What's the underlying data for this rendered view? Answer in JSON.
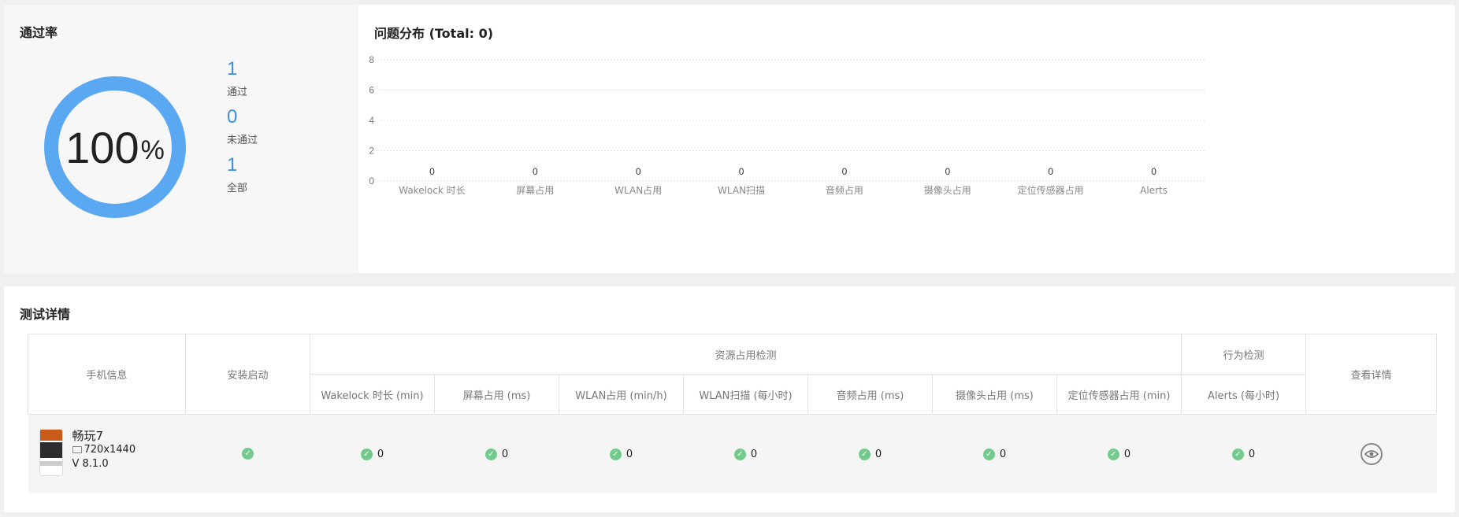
{
  "pass_rate": {
    "title": "通过率",
    "percent_value": "100",
    "percent_sign": "%",
    "pass_fraction": 1.0,
    "passed": {
      "value": "1",
      "label": "通过"
    },
    "failed": {
      "value": "0",
      "label": "未通过"
    },
    "total": {
      "value": "1",
      "label": "全部"
    },
    "colors": {
      "arc": "#5aa8f2",
      "track": "#e6e6e6",
      "value": "#3d8fe0"
    }
  },
  "issues": {
    "title": "问题分布 (Total: 0)"
  },
  "chart_data": {
    "type": "bar",
    "title": "问题分布 (Total: 0)",
    "categories": [
      "Wakelock 时长",
      "屏幕占用",
      "WLAN占用",
      "WLAN扫描",
      "音频占用",
      "摄像头占用",
      "定位传感器占用",
      "Alerts"
    ],
    "values": [
      0,
      0,
      0,
      0,
      0,
      0,
      0,
      0
    ],
    "data_labels": [
      "0",
      "0",
      "0",
      "0",
      "0",
      "0",
      "0",
      "0"
    ],
    "yticks": [
      "0",
      "2",
      "4",
      "6",
      "8"
    ],
    "ylim": [
      0,
      8
    ],
    "grid": true,
    "xlabel": "",
    "ylabel": ""
  },
  "detail": {
    "title": "测试详情",
    "headers": {
      "phone_info": "手机信息",
      "install_launch": "安装启动",
      "resource_group": "资源占用检测",
      "behavior_group": "行为检测",
      "view_detail": "查看详情",
      "columns": [
        "Wakelock 时长 (min)",
        "屏幕占用 (ms)",
        "WLAN占用 (min/h)",
        "WLAN扫描 (每小时)",
        "音频占用 (ms)",
        "摄像头占用 (ms)",
        "定位传感器占用 (min)",
        "Alerts (每小时)"
      ]
    },
    "rows": [
      {
        "app_name": "畅玩7",
        "resolution": "720x1440",
        "version": "V 8.1.0",
        "values": [
          "0",
          "0",
          "0",
          "0",
          "0",
          "0",
          "0",
          "0"
        ]
      }
    ],
    "colors": {
      "ok": "#74c98c"
    }
  }
}
